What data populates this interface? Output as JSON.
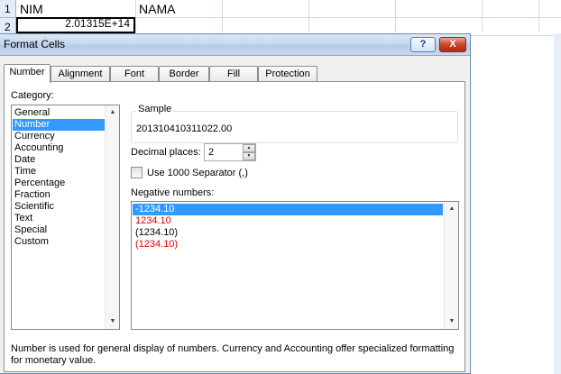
{
  "sheet": {
    "rows": [
      {
        "num": "1",
        "a": "NIM",
        "b": "NAMA"
      },
      {
        "num": "2",
        "a_value": "2.01315E+14"
      }
    ]
  },
  "dialog": {
    "title": "Format Cells",
    "help_label": "?",
    "close_label": "X",
    "tabs": [
      {
        "label": "Number",
        "active": true
      },
      {
        "label": "Alignment",
        "active": false
      },
      {
        "label": "Font",
        "active": false
      },
      {
        "label": "Border",
        "active": false
      },
      {
        "label": "Fill",
        "active": false
      },
      {
        "label": "Protection",
        "active": false
      }
    ],
    "category_label": "Category:",
    "categories": [
      "General",
      "Number",
      "Currency",
      "Accounting",
      "Date",
      "Time",
      "Percentage",
      "Fraction",
      "Scientific",
      "Text",
      "Special",
      "Custom"
    ],
    "selected_category": "Number",
    "sample_label": "Sample",
    "sample_value": "201310410311022.00",
    "decimal_places_label": "Decimal places:",
    "decimal_places_value": "2",
    "separator_label": "Use 1000 Separator (,)",
    "separator_checked": false,
    "negative_numbers_label": "Negative numbers:",
    "negative_numbers": [
      {
        "text": "-1234.10",
        "color": "#000000",
        "selected": true
      },
      {
        "text": "1234.10",
        "color": "#e00000",
        "selected": false
      },
      {
        "text": "(1234.10)",
        "color": "#000000",
        "selected": false
      },
      {
        "text": "(1234.10)",
        "color": "#e00000",
        "selected": false
      }
    ],
    "description": "Number is used for general display of numbers.  Currency and Accounting offer specialized formatting for monetary value."
  },
  "colors": {
    "selection": "#3399ff",
    "negative_red": "#e00000"
  }
}
